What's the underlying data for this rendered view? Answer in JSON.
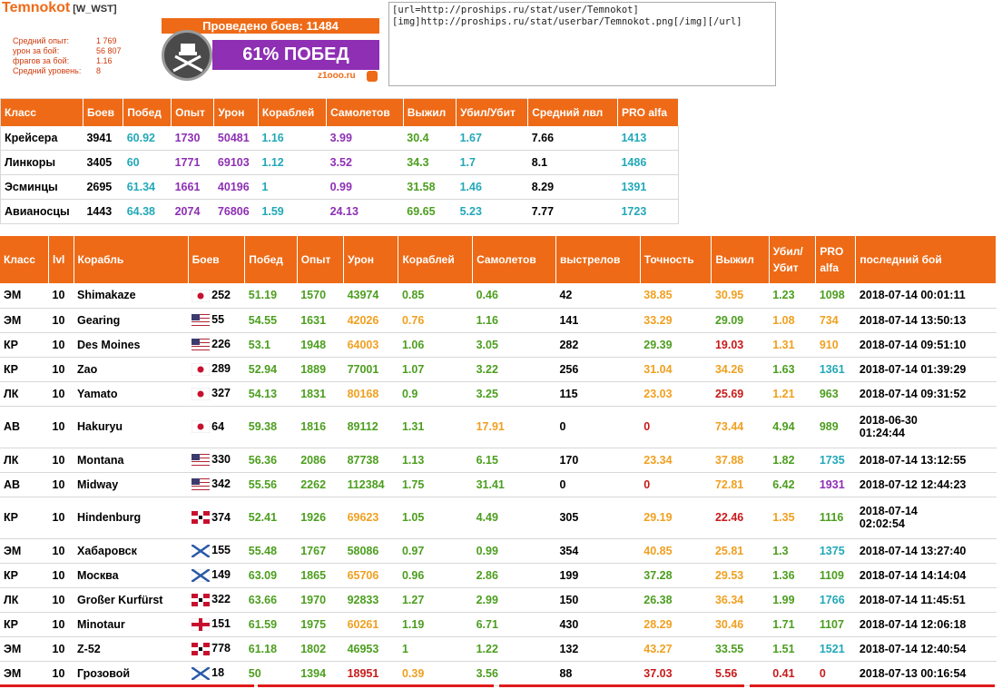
{
  "userbar": {
    "name": "Temnokot",
    "clan": "[W_WST]",
    "battles_text": "Проведено боев: 11484",
    "win_text": "61% ПОБЕД",
    "site": "z1ooo.ru",
    "stats": [
      {
        "key": "Средний опыт:",
        "value": "1 769"
      },
      {
        "key": "урон за бой:",
        "value": "56 807"
      },
      {
        "key": "фрагов за бой:",
        "value": "1.16"
      },
      {
        "key": "Средний уровень:",
        "value": "8"
      }
    ]
  },
  "bbcode": "[url=http://proships.ru/stat/user/Temnokot]\n[img]http://proships.ru/stat/userbar/Temnokot.png[/img][/url]",
  "class_table": {
    "headers": [
      "Класс",
      "Боев",
      "Побед",
      "Опыт",
      "Урон",
      "Кораблей",
      "Самолетов",
      "Выжил",
      "Убил/Убит",
      "Средний лвл",
      "PRO alfa"
    ],
    "rows": [
      [
        "Крейсера",
        "3941",
        "60.92",
        "1730",
        "50481",
        "1.16",
        "3.99",
        "30.4",
        "1.67",
        "7.66",
        "1413"
      ],
      [
        "Линкоры",
        "3405",
        "60",
        "1771",
        "69103",
        "1.12",
        "3.52",
        "34.3",
        "1.7",
        "8.1",
        "1486"
      ],
      [
        "Эсминцы",
        "2695",
        "61.34",
        "1661",
        "40196",
        "1",
        "0.99",
        "31.58",
        "1.46",
        "8.29",
        "1391"
      ],
      [
        "Авианосцы",
        "1443",
        "64.38",
        "2074",
        "76806",
        "1.59",
        "24.13",
        "69.65",
        "5.23",
        "7.77",
        "1723"
      ]
    ],
    "colors": [
      "c-dark",
      "c-dark",
      "c-teal",
      "c-purple",
      "c-purple",
      "c-teal",
      "c-purple",
      "c-green",
      "c-teal",
      "c-dark",
      "c-teal"
    ]
  },
  "ships_table": {
    "headers": [
      "Класс",
      "lvl",
      "Корабль",
      "Боев",
      "Побед",
      "Опыт",
      "Урон",
      "Кораблей",
      "Самолетов",
      "выстрелов",
      "Точность",
      "Выжил",
      "Убил/\nУбит",
      "PRO\nalfa",
      "последний бой"
    ],
    "rows": [
      {
        "cls": "ЭМ",
        "lvl": "10",
        "ship": "Shimakaze",
        "flag": "jp",
        "battles": "252",
        "win": "51.19",
        "xp": "1570",
        "dmg": "43974",
        "kills": "0.85",
        "planes": "0.46",
        "shots": "42",
        "acc": "38.85",
        "surv": "30.95",
        "kd": "1.23",
        "pro": "1098",
        "last": "2018-07-14 00:01:11",
        "cc": {
          "win": "c-green",
          "xp": "c-green",
          "dmg": "c-green",
          "kills": "c-green",
          "planes": "c-green",
          "acc": "c-orange",
          "surv": "c-orange",
          "kd": "c-green",
          "pro": "c-green"
        }
      },
      {
        "cls": "ЭМ",
        "lvl": "10",
        "ship": "Gearing",
        "flag": "us",
        "battles": "55",
        "win": "54.55",
        "xp": "1631",
        "dmg": "42026",
        "kills": "0.76",
        "planes": "1.16",
        "shots": "141",
        "acc": "33.29",
        "surv": "29.09",
        "kd": "1.08",
        "pro": "734",
        "last": "2018-07-14 13:50:13",
        "cc": {
          "win": "c-green",
          "xp": "c-green",
          "dmg": "c-orange",
          "kills": "c-orange",
          "planes": "c-green",
          "acc": "c-orange",
          "surv": "c-green",
          "kd": "c-orange",
          "pro": "c-orange"
        }
      },
      {
        "cls": "КР",
        "lvl": "10",
        "ship": "Des Moines",
        "flag": "us",
        "battles": "226",
        "win": "53.1",
        "xp": "1948",
        "dmg": "64003",
        "kills": "1.06",
        "planes": "3.05",
        "shots": "282",
        "acc": "29.39",
        "surv": "19.03",
        "kd": "1.31",
        "pro": "910",
        "last": "2018-07-14 09:51:10",
        "cc": {
          "win": "c-green",
          "xp": "c-green",
          "dmg": "c-orange",
          "kills": "c-green",
          "planes": "c-green",
          "acc": "c-green",
          "surv": "c-red",
          "kd": "c-orange",
          "pro": "c-orange"
        }
      },
      {
        "cls": "КР",
        "lvl": "10",
        "ship": "Zao",
        "flag": "jp",
        "battles": "289",
        "win": "52.94",
        "xp": "1889",
        "dmg": "77001",
        "kills": "1.07",
        "planes": "3.22",
        "shots": "256",
        "acc": "31.04",
        "surv": "34.26",
        "kd": "1.63",
        "pro": "1361",
        "last": "2018-07-14 01:39:29",
        "cc": {
          "win": "c-green",
          "xp": "c-green",
          "dmg": "c-green",
          "kills": "c-green",
          "planes": "c-green",
          "acc": "c-orange",
          "surv": "c-orange",
          "kd": "c-green",
          "pro": "c-teal"
        }
      },
      {
        "cls": "ЛК",
        "lvl": "10",
        "ship": "Yamato",
        "flag": "jp",
        "battles": "327",
        "win": "54.13",
        "xp": "1831",
        "dmg": "80168",
        "kills": "0.9",
        "planes": "3.25",
        "shots": "115",
        "acc": "23.03",
        "surv": "25.69",
        "kd": "1.21",
        "pro": "963",
        "last": "2018-07-14 09:31:52",
        "cc": {
          "win": "c-green",
          "xp": "c-green",
          "dmg": "c-orange",
          "kills": "c-green",
          "planes": "c-green",
          "acc": "c-orange",
          "surv": "c-red",
          "kd": "c-orange",
          "pro": "c-green"
        }
      },
      {
        "cls": "АВ",
        "lvl": "10",
        "ship": "Hakuryu",
        "flag": "jp",
        "battles": "64",
        "win": "59.38",
        "xp": "1816",
        "dmg": "89112",
        "kills": "1.31",
        "planes": "17.91",
        "shots": "0",
        "acc": "0",
        "surv": "73.44",
        "kd": "4.94",
        "pro": "989",
        "last": "2018-06-30\n01:24:44",
        "tall": true,
        "cc": {
          "win": "c-green",
          "xp": "c-green",
          "dmg": "c-green",
          "kills": "c-green",
          "planes": "c-orange",
          "acc": "c-red",
          "surv": "c-orange",
          "kd": "c-green",
          "pro": "c-green"
        }
      },
      {
        "cls": "ЛК",
        "lvl": "10",
        "ship": "Montana",
        "flag": "us",
        "battles": "330",
        "win": "56.36",
        "xp": "2086",
        "dmg": "87738",
        "kills": "1.13",
        "planes": "6.15",
        "shots": "170",
        "acc": "23.34",
        "surv": "37.88",
        "kd": "1.82",
        "pro": "1735",
        "last": "2018-07-14 13:12:55",
        "cc": {
          "win": "c-green",
          "xp": "c-green",
          "dmg": "c-green",
          "kills": "c-green",
          "planes": "c-green",
          "acc": "c-orange",
          "surv": "c-orange",
          "kd": "c-green",
          "pro": "c-teal"
        }
      },
      {
        "cls": "АВ",
        "lvl": "10",
        "ship": "Midway",
        "flag": "us",
        "battles": "342",
        "win": "55.56",
        "xp": "2262",
        "dmg": "112384",
        "kills": "1.75",
        "planes": "31.41",
        "shots": "0",
        "acc": "0",
        "surv": "72.81",
        "kd": "6.42",
        "pro": "1931",
        "last": "2018-07-12 12:44:23",
        "cc": {
          "win": "c-green",
          "xp": "c-green",
          "dmg": "c-green",
          "kills": "c-green",
          "planes": "c-green",
          "acc": "c-red",
          "surv": "c-orange",
          "kd": "c-green",
          "pro": "c-purple"
        }
      },
      {
        "cls": "КР",
        "lvl": "10",
        "ship": "Hindenburg",
        "flag": "de",
        "battles": "374",
        "win": "52.41",
        "xp": "1926",
        "dmg": "69623",
        "kills": "1.05",
        "planes": "4.49",
        "shots": "305",
        "acc": "29.19",
        "surv": "22.46",
        "kd": "1.35",
        "pro": "1116",
        "last": "2018-07-14\n02:02:54",
        "tall": true,
        "cc": {
          "win": "c-green",
          "xp": "c-green",
          "dmg": "c-orange",
          "kills": "c-green",
          "planes": "c-green",
          "acc": "c-orange",
          "surv": "c-red",
          "kd": "c-orange",
          "pro": "c-green"
        }
      },
      {
        "cls": "ЭМ",
        "lvl": "10",
        "ship": "Хабаровск",
        "flag": "ru",
        "battles": "155",
        "win": "55.48",
        "xp": "1767",
        "dmg": "58086",
        "kills": "0.97",
        "planes": "0.99",
        "shots": "354",
        "acc": "40.85",
        "surv": "25.81",
        "kd": "1.3",
        "pro": "1375",
        "last": "2018-07-14 13:27:40",
        "cc": {
          "win": "c-green",
          "xp": "c-green",
          "dmg": "c-green",
          "kills": "c-green",
          "planes": "c-green",
          "acc": "c-orange",
          "surv": "c-orange",
          "kd": "c-green",
          "pro": "c-teal"
        }
      },
      {
        "cls": "КР",
        "lvl": "10",
        "ship": "Москва",
        "flag": "ru",
        "battles": "149",
        "win": "63.09",
        "xp": "1865",
        "dmg": "65706",
        "kills": "0.96",
        "planes": "2.86",
        "shots": "199",
        "acc": "37.28",
        "surv": "29.53",
        "kd": "1.36",
        "pro": "1109",
        "last": "2018-07-14 14:14:04",
        "cc": {
          "win": "c-green",
          "xp": "c-green",
          "dmg": "c-orange",
          "kills": "c-green",
          "planes": "c-green",
          "acc": "c-green",
          "surv": "c-orange",
          "kd": "c-green",
          "pro": "c-green"
        }
      },
      {
        "cls": "ЛК",
        "lvl": "10",
        "ship": "Großer Kurfürst",
        "flag": "de",
        "battles": "322",
        "win": "63.66",
        "xp": "1970",
        "dmg": "92833",
        "kills": "1.27",
        "planes": "2.99",
        "shots": "150",
        "acc": "26.38",
        "surv": "36.34",
        "kd": "1.99",
        "pro": "1766",
        "last": "2018-07-14 11:45:51",
        "cc": {
          "win": "c-green",
          "xp": "c-green",
          "dmg": "c-green",
          "kills": "c-green",
          "planes": "c-green",
          "acc": "c-green",
          "surv": "c-orange",
          "kd": "c-green",
          "pro": "c-teal"
        }
      },
      {
        "cls": "КР",
        "lvl": "10",
        "ship": "Minotaur",
        "flag": "uk",
        "battles": "151",
        "win": "61.59",
        "xp": "1975",
        "dmg": "60261",
        "kills": "1.19",
        "planes": "6.71",
        "shots": "430",
        "acc": "28.29",
        "surv": "30.46",
        "kd": "1.71",
        "pro": "1107",
        "last": "2018-07-14 12:06:18",
        "cc": {
          "win": "c-green",
          "xp": "c-green",
          "dmg": "c-orange",
          "kills": "c-green",
          "planes": "c-green",
          "acc": "c-orange",
          "surv": "c-orange",
          "kd": "c-green",
          "pro": "c-green"
        }
      },
      {
        "cls": "ЭМ",
        "lvl": "10",
        "ship": "Z-52",
        "flag": "de",
        "battles": "778",
        "win": "61.18",
        "xp": "1802",
        "dmg": "46953",
        "kills": "1",
        "planes": "1.22",
        "shots": "132",
        "acc": "43.27",
        "surv": "33.55",
        "kd": "1.51",
        "pro": "1521",
        "last": "2018-07-14 12:40:54",
        "cc": {
          "win": "c-green",
          "xp": "c-green",
          "dmg": "c-green",
          "kills": "c-green",
          "planes": "c-green",
          "acc": "c-orange",
          "surv": "c-green",
          "kd": "c-green",
          "pro": "c-teal"
        }
      },
      {
        "cls": "ЭМ",
        "lvl": "10",
        "ship": "Грозовой",
        "flag": "ru",
        "battles": "18",
        "win": "50",
        "xp": "1394",
        "dmg": "18951",
        "kills": "0.39",
        "planes": "3.56",
        "shots": "88",
        "acc": "37.03",
        "surv": "5.56",
        "kd": "0.41",
        "pro": "0",
        "last": "2018-07-13 00:16:54",
        "cc": {
          "win": "c-green",
          "xp": "c-green",
          "dmg": "c-red",
          "kills": "c-orange",
          "planes": "c-green",
          "acc": "c-red",
          "surv": "c-red",
          "kd": "c-red",
          "pro": "c-red"
        }
      }
    ]
  }
}
